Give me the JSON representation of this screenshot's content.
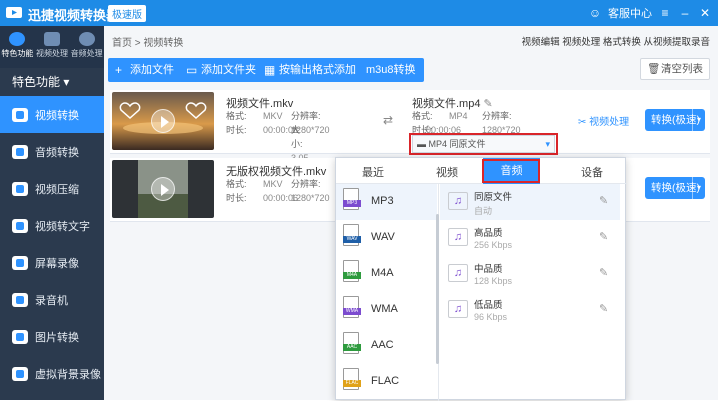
{
  "titlebar": {
    "app_name": "迅捷视频转换器",
    "edition_badge": "极速版",
    "support_label": "客服中心"
  },
  "sidebar": {
    "top_items": [
      {
        "label": "特色功能",
        "active": true
      },
      {
        "label": "视频处理",
        "active": false
      },
      {
        "label": "音频处理",
        "active": false
      }
    ],
    "section_label": "特色功能",
    "items": [
      {
        "label": "视频转换",
        "active": true
      },
      {
        "label": "音频转换",
        "active": false
      },
      {
        "label": "视频压缩",
        "active": false
      },
      {
        "label": "视频转文字",
        "active": false
      },
      {
        "label": "屏幕录像",
        "active": false
      },
      {
        "label": "录音机",
        "active": false
      },
      {
        "label": "图片转换",
        "active": false
      },
      {
        "label": "虚拟背景录像",
        "active": false
      }
    ]
  },
  "breadcrumb": {
    "home": "首页",
    "separator": ">",
    "current": "视频转换"
  },
  "promo_links": "视频编辑 视频处理 格式转换 从视频提取录音",
  "toolbar": {
    "add_file": "添加文件",
    "add_folder": "添加文件夹",
    "add_by_format": "按输出格式添加",
    "m3u8": "m3u8转换",
    "clear_list": "清空列表"
  },
  "files": [
    {
      "name": "视频文件.mkv",
      "format_label": "格式:",
      "format": "MKV",
      "resolution_label": "分辨率:",
      "resolution": "1280*720",
      "duration_label": "时长:",
      "duration": "00:00:06",
      "size_label": "大小:",
      "size": "3.05 MB",
      "output_name": "视频文件.mp4",
      "out_format": "MP4",
      "out_resolution": "1280*720",
      "out_duration": "00:00:06",
      "output_select": "MP4  同原文件",
      "process_label": "视频处理",
      "convert_label": "转换(极速)"
    },
    {
      "name": "无版权视频文件.mkv",
      "format_label": "格式:",
      "format": "MKV",
      "resolution_label": "分辨率:",
      "resolution": "1280*720",
      "duration_label": "时长:",
      "duration": "00:00:06",
      "convert_label": "转换(极速)"
    }
  ],
  "dropdown": {
    "tabs": [
      "最近",
      "视频",
      "音频",
      "设备"
    ],
    "active_tab": "音频",
    "formats": [
      {
        "label": "MP3",
        "color": "#7c4ccf"
      },
      {
        "label": "WAV",
        "color": "#1f5fa8"
      },
      {
        "label": "M4A",
        "color": "#2e9b3e"
      },
      {
        "label": "WMA",
        "color": "#7c4ccf"
      },
      {
        "label": "AAC",
        "color": "#2e9b3e"
      },
      {
        "label": "FLAC",
        "color": "#e0a21a"
      }
    ],
    "qualities": [
      {
        "name": "同原文件",
        "detail": "自动"
      },
      {
        "name": "高品质",
        "detail": "256 Kbps"
      },
      {
        "name": "中品质",
        "detail": "128 Kbps"
      },
      {
        "name": "低品质",
        "detail": "96 Kbps"
      }
    ]
  }
}
